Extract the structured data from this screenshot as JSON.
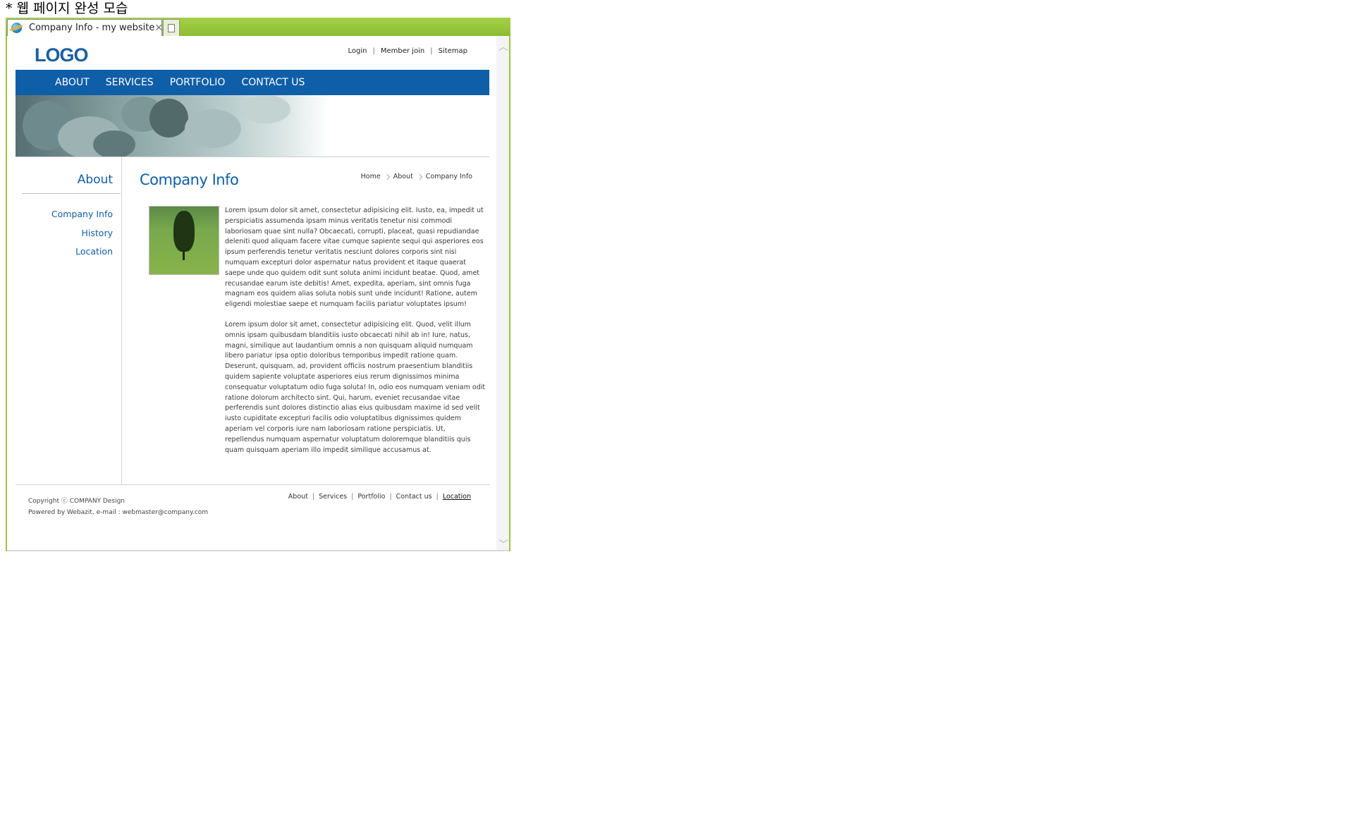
{
  "caption": "* 웹 페이지 완성 모습",
  "browser": {
    "tab_title": "Company Info - my website",
    "accent_color": "#9ac53e"
  },
  "site": {
    "logo": "LOGO",
    "utility": [
      "Login",
      "Member join",
      "Sitemap"
    ],
    "gnb": [
      "ABOUT",
      "SERVICES",
      "PORTFOLIO",
      "CONTACT US"
    ],
    "brand_color": "#0f5ea8"
  },
  "sidebar": {
    "title": "About",
    "items": [
      "Company Info",
      "History",
      "Location"
    ]
  },
  "content": {
    "title": "Company Info",
    "breadcrumb": [
      "Home",
      "About",
      "Company Info"
    ],
    "paragraphs": [
      "Lorem ipsum dolor sit amet, consectetur adipisicing elit. Iusto, ea, impedit ut perspiciatis assumenda ipsam minus veritatis tenetur nisi commodi laboriosam quae sint nulla? Obcaecati, corrupti, placeat, quasi repudiandae deleniti quod aliquam facere vitae cumque sapiente sequi qui asperiores eos ipsum perferendis tenetur veritatis nesciunt dolores corporis sint nisi numquam excepturi dolor aspernatur natus provident et itaque quaerat saepe unde quo quidem odit sunt soluta animi incidunt beatae. Quod, amet recusandae earum iste debitis! Amet, expedita, aperiam, sint omnis fuga magnam eos quidem alias soluta nobis sunt unde incidunt! Ratione, autem eligendi molestiae saepe et numquam facilis pariatur voluptates ipsum!",
      "Lorem ipsum dolor sit amet, consectetur adipisicing elit. Quod, velit illum omnis ipsam quibusdam blanditiis iusto obcaecati nihil ab in! Iure, natus, magni, similique aut laudantium omnis a non quisquam aliquid numquam libero pariatur ipsa optio doloribus temporibus impedit ratione quam. Deserunt, quisquam, ad, provident officiis nostrum praesentium blanditiis quidem sapiente voluptate asperiores eius rerum dignissimos minima consequatur voluptatum odio fuga soluta! In, odio eos numquam veniam odit ratione dolorum architecto sint. Qui, harum, eveniet recusandae vitae perferendis sunt dolores distinctio alias eius quibusdam maxime id sed velit iusto cupiditate excepturi facilis odio voluptatibus dignissimos quidem aperiam vel corporis iure nam laboriosam ratione perspiciatis. Ut, repellendus numquam aspernatur voluptatum doloremque blanditiis quis quam quisquam aperiam illo impedit similique accusamus at."
    ]
  },
  "footer": {
    "copyright": "Copyright ⓒ COMPANY Design",
    "powered": "Powered by Webazit, e-mail : webmaster@company.com",
    "links": [
      "About",
      "Services",
      "Portfolio",
      "Contact us",
      "Location"
    ]
  }
}
